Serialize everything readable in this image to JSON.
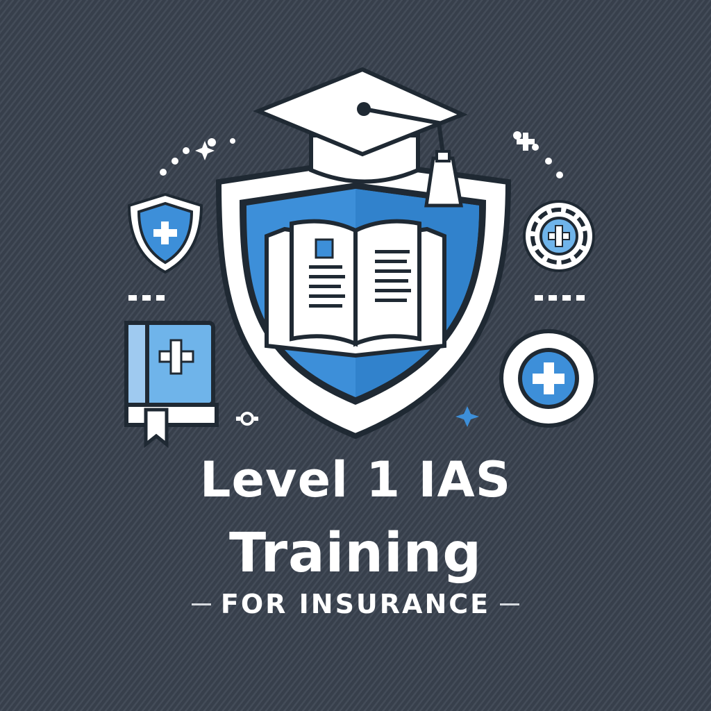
{
  "title": {
    "line1": "Level 1 IAS",
    "line2": "Training"
  },
  "tagline": "FOR INSURANCE",
  "colors": {
    "background": "#3a4350",
    "accent_blue": "#3d8fd9",
    "light_blue": "#6fb4ea",
    "white": "#ffffff",
    "outline": "#1f2933"
  },
  "icons": [
    "graduation-cap-icon",
    "shield-icon",
    "open-book-icon",
    "shield-plus-icon",
    "book-plus-icon",
    "gear-plus-icon",
    "circle-plus-icon",
    "sparkle-icon"
  ]
}
